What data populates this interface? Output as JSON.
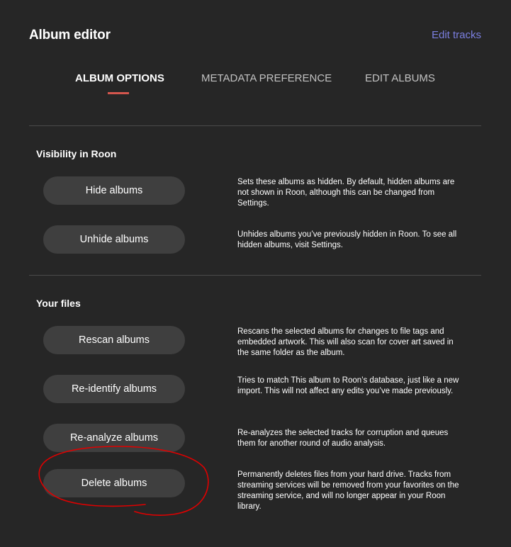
{
  "header": {
    "title": "Album editor",
    "edit_tracks_link": "Edit tracks"
  },
  "tabs": [
    {
      "label": "ALBUM OPTIONS",
      "active": true
    },
    {
      "label": "METADATA PREFERENCE",
      "active": false
    },
    {
      "label": "EDIT ALBUMS",
      "active": false
    }
  ],
  "sections": {
    "visibility": {
      "title": "Visibility in Roon",
      "items": [
        {
          "button": "Hide albums",
          "description": "Sets these albums as hidden. By default, hidden albums are not shown in Roon, although this can be changed from Settings."
        },
        {
          "button": "Unhide albums",
          "description": "Unhides albums you’ve previously hidden in Roon. To see all hidden albums, visit Settings."
        }
      ]
    },
    "files": {
      "title": "Your files",
      "items": [
        {
          "button": "Rescan albums",
          "description": "Rescans the selected albums for changes to file tags and embedded artwork. This will also scan for cover art saved in the same folder as the album."
        },
        {
          "button": "Re-identify albums",
          "description": "Tries to match This album to Roon’s database, just like a new import. This will not affect any edits you’ve made previously."
        },
        {
          "button": "Re-analyze albums",
          "description": "Re-analyzes the selected tracks for corruption and queues them for another round of audio analysis."
        },
        {
          "button": "Delete albums",
          "description": "Permanently deletes files from your hard drive. Tracks from streaming services will be removed from your favorites on the streaming service, and will no longer appear in your Roon library."
        }
      ]
    }
  },
  "colors": {
    "background": "#262626",
    "button": "#3f3f3f",
    "link": "#7b7fe0",
    "tab_underline": "#d4564d",
    "annotation": "#e00000"
  }
}
